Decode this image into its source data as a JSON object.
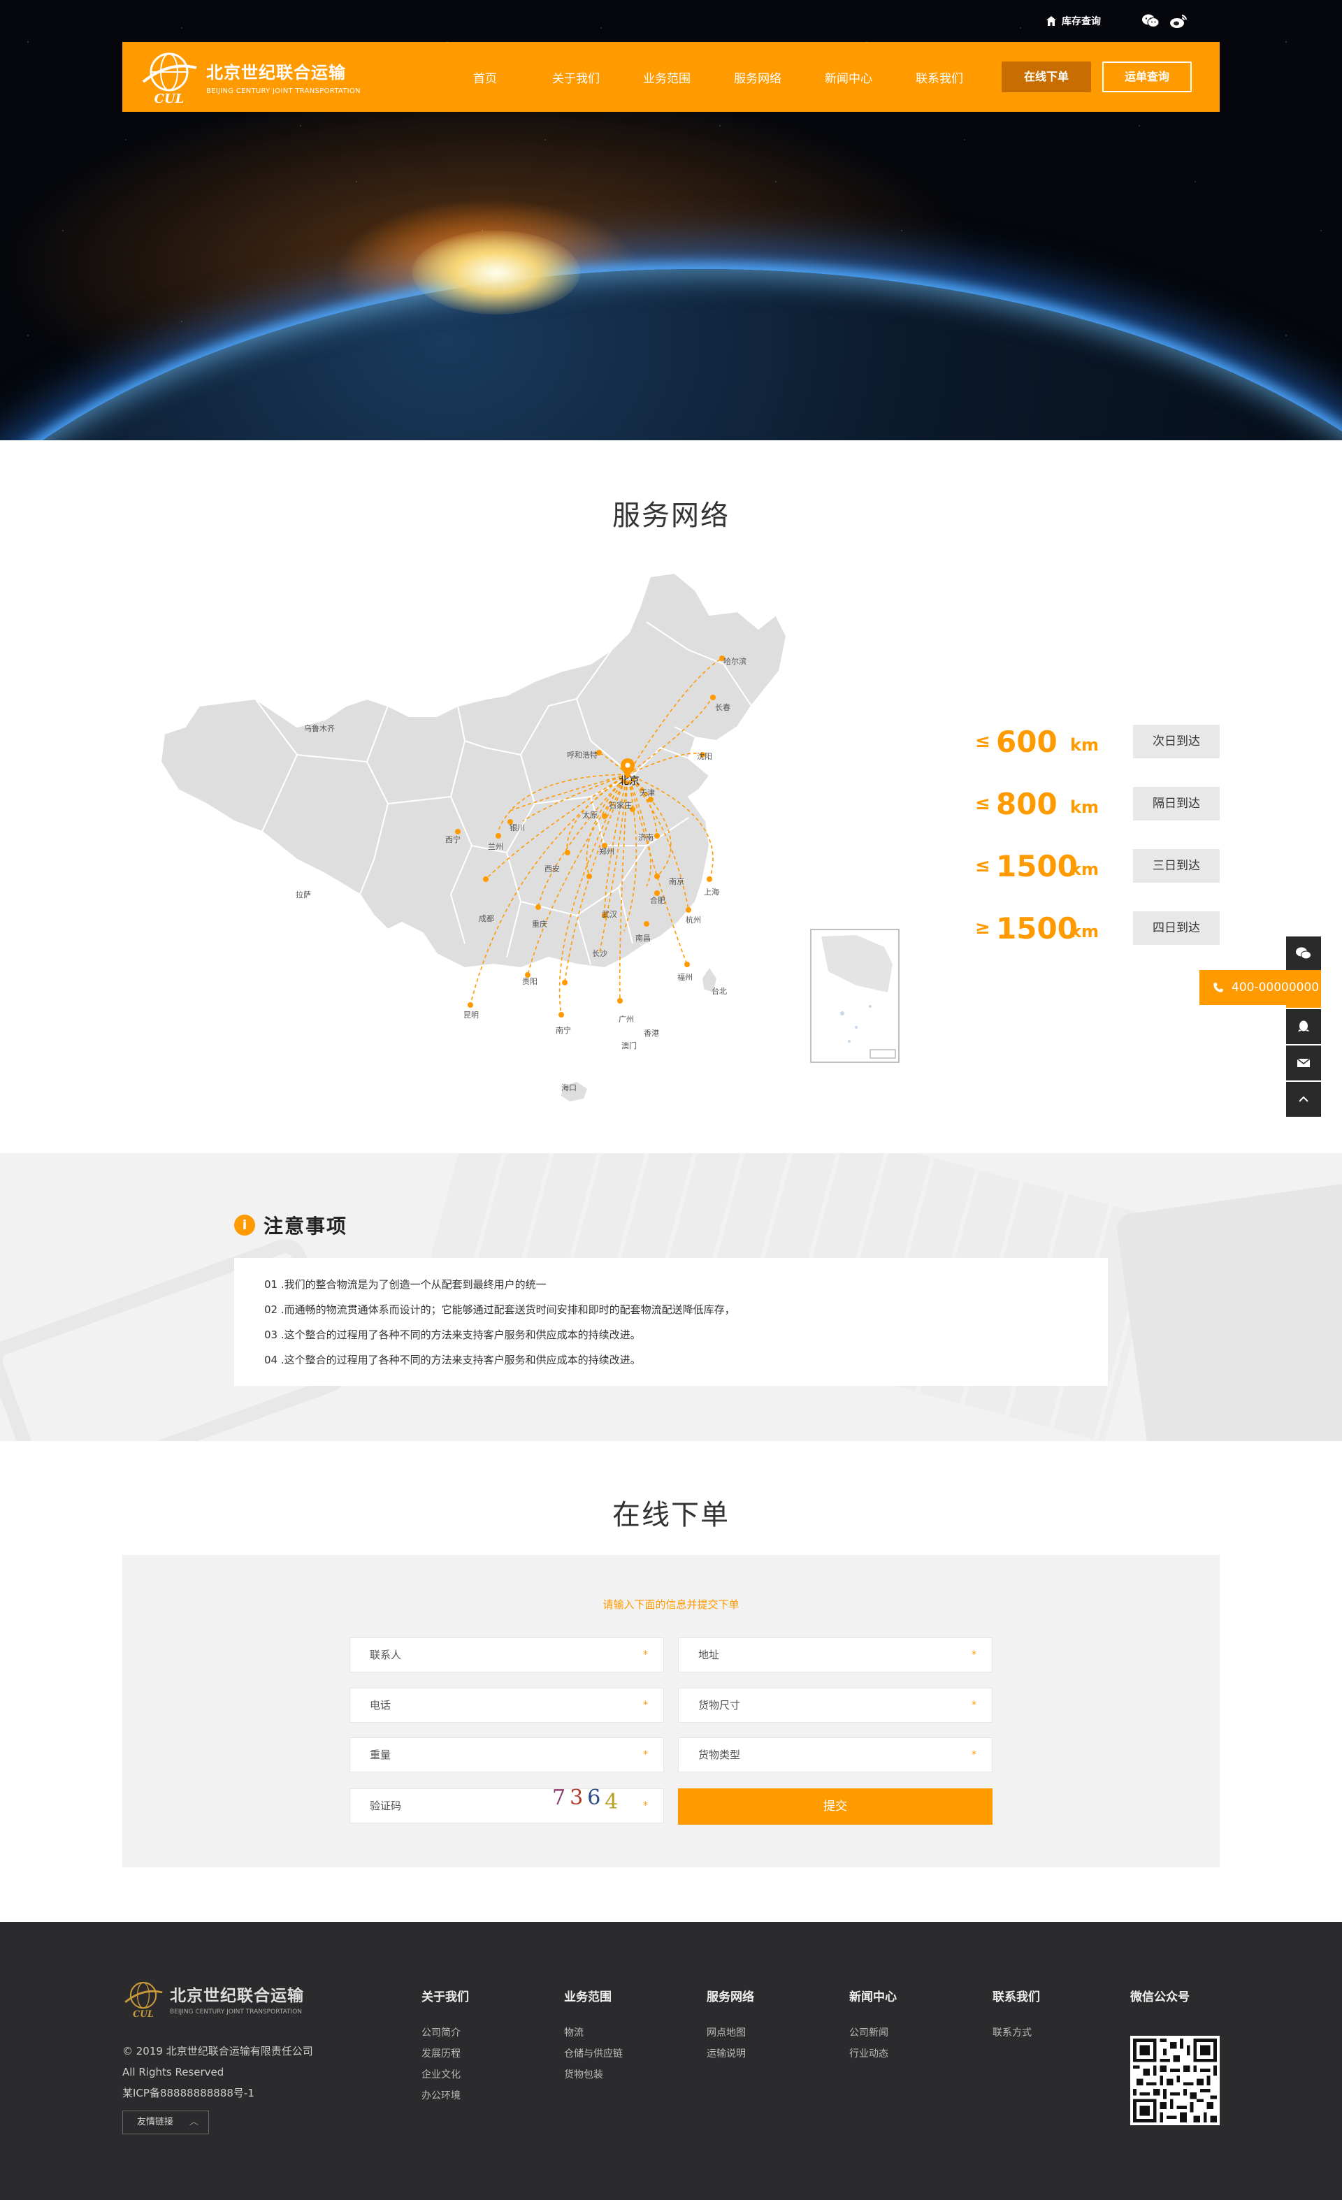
{
  "topbar": {
    "inventory": "库存查询",
    "wechat_icon": "wechat-icon",
    "weibo_icon": "weibo-icon"
  },
  "brand": {
    "name_cn": "北京世纪联合运输",
    "name_en": "BEIJING CENTURY JOINT TRANSPORTATION",
    "mark": "CUL"
  },
  "nav": {
    "items": [
      "首页",
      "关于我们",
      "业务范围",
      "服务网络",
      "新闻中心",
      "联系我们"
    ],
    "order_btn": "在线下单",
    "track_btn": "运单查询"
  },
  "colors": {
    "accent": "#ff9a00",
    "accent_dark": "#c86e00",
    "footer": "#2b2b2d"
  },
  "network": {
    "title": "服务网络",
    "hub": "北京",
    "cities": [
      "哈尔滨",
      "长春",
      "沈阳",
      "呼和浩特",
      "天津",
      "石家庄",
      "太原",
      "济南",
      "银川",
      "兰州",
      "西宁",
      "郑州",
      "西安",
      "上海",
      "南京",
      "合肥",
      "武汉",
      "成都",
      "重庆",
      "杭州",
      "南昌",
      "长沙",
      "福州",
      "贵阳",
      "昆明",
      "南宁",
      "广州",
      "香港",
      "澳门",
      "台北",
      "海口",
      "乌鲁木齐",
      "拉萨"
    ],
    "tiers": [
      {
        "sym": "≤",
        "num": "600",
        "unit": "km",
        "label": "次日到达"
      },
      {
        "sym": "≤",
        "num": "800",
        "unit": "km",
        "label": "隔日到达"
      },
      {
        "sym": "≤",
        "num": "1500",
        "unit": "km",
        "label": "三日到达"
      },
      {
        "sym": "≥",
        "num": "1500",
        "unit": "km",
        "label": "四日到达"
      }
    ]
  },
  "float": {
    "phone": "400-00000000"
  },
  "notice": {
    "title": "注意事项",
    "items": [
      "01 .我们的整合物流是为了创造一个从配套到最终用户的统一",
      "02 .而通畅的物流贯通体系而设计的；它能够通过配套送货时间安排和即时的配套物流配送降低库存，",
      "03 .这个整合的过程用了各种不同的方法来支持客户服务和供应成本的持续改进。",
      "04 .这个整合的过程用了各种不同的方法来支持客户服务和供应成本的持续改进。"
    ]
  },
  "order": {
    "title": "在线下单",
    "hint": "请输入下面的信息并提交下单",
    "fields": {
      "contact": "联系人",
      "address": "地址",
      "phone": "电话",
      "size": "货物尺寸",
      "weight": "重量",
      "type": "货物类型",
      "captcha": "验证码"
    },
    "required_mark": "*",
    "captcha_digits": [
      "7",
      "3",
      "6",
      "4"
    ],
    "submit": "提交"
  },
  "footer": {
    "copy1": "© 2019 北京世纪联合运输有限责任公司",
    "copy2": "All Rights Reserved",
    "icp": "某ICP备88888888888号-1",
    "links_btn": "友情链接",
    "cols": [
      {
        "title": "关于我们",
        "items": [
          "公司简介",
          "发展历程",
          "企业文化",
          "办公环境"
        ]
      },
      {
        "title": "业务范围",
        "items": [
          "物流",
          "仓储与供应链",
          "货物包装"
        ]
      },
      {
        "title": "服务网络",
        "items": [
          "网点地图",
          "运输说明"
        ]
      },
      {
        "title": "新闻中心",
        "items": [
          "公司新闻",
          "行业动态"
        ]
      },
      {
        "title": "联系我们",
        "items": [
          "联系方式"
        ]
      }
    ],
    "wechat_title": "微信公众号"
  }
}
